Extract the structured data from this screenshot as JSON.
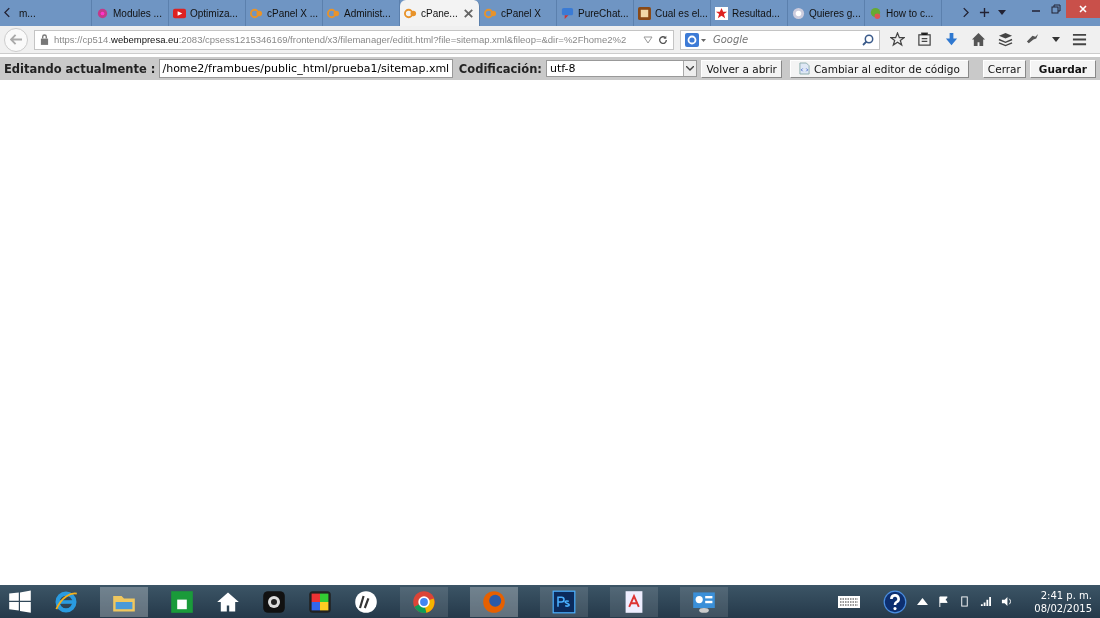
{
  "tabs": [
    {
      "title": "m...",
      "selected": false
    },
    {
      "title": "Modules ...",
      "selected": false
    },
    {
      "title": "Optimiza...",
      "selected": false
    },
    {
      "title": "cPanel X ...",
      "selected": false
    },
    {
      "title": "Administ...",
      "selected": false
    },
    {
      "title": "cPane...",
      "selected": true
    },
    {
      "title": "cPanel X",
      "selected": false
    },
    {
      "title": "PureChat...",
      "selected": false
    },
    {
      "title": "Cual es el...",
      "selected": false
    },
    {
      "title": "Resultad...",
      "selected": false
    },
    {
      "title": "Quieres g...",
      "selected": false
    },
    {
      "title": "How to c...",
      "selected": false
    }
  ],
  "address_bar": {
    "scheme": "https://cp514.",
    "host": "webempresa.eu",
    "rest": ":2083/cpsess1215346169/frontend/x3/filemanager/editit.html?file=sitemap.xml&fileop=&dir=%2Fhome2%2"
  },
  "search": {
    "placeholder": "Google"
  },
  "editor_toolbar": {
    "file_label": "Editando actualmente :",
    "file_path": "/home2/frambues/public_html/prueba1/sitemap.xml",
    "encoding_label": "Codificación:",
    "encoding": "utf-8",
    "reopen_button": "Volver a abrir",
    "code_editor_button": "Cambiar al editor de código",
    "close_button": "Cerrar",
    "save_button": "Guardar"
  },
  "taskbar": {
    "time": "2:41 p. m.",
    "date": "08/02/2015"
  }
}
